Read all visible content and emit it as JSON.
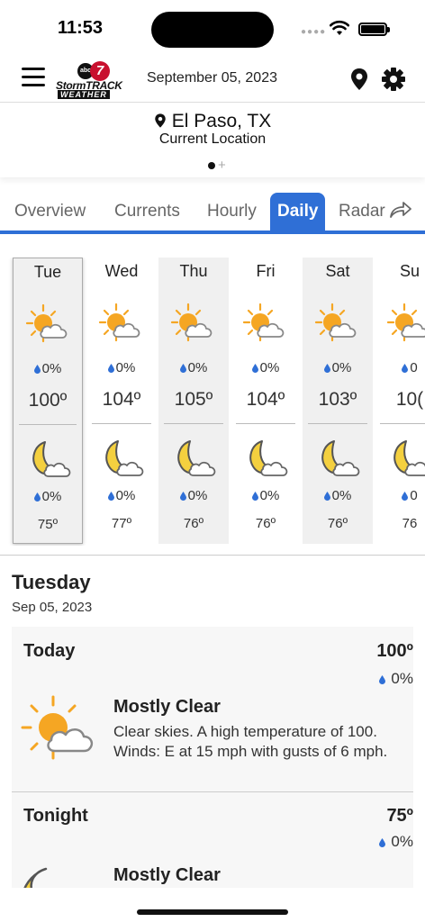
{
  "status_bar": {
    "time": "11:53"
  },
  "header": {
    "brand_line1": "StormTRACK",
    "brand_line2": "WEATHER",
    "brand_badge_abc": "abc",
    "brand_badge_num": "7",
    "date": "September 05, 2023"
  },
  "location": {
    "title": "El Paso, TX",
    "subtitle": "Current Location"
  },
  "tabs": [
    {
      "label": "Overview"
    },
    {
      "label": "Currents"
    },
    {
      "label": "Hourly"
    },
    {
      "label": "Daily"
    },
    {
      "label": "Radar"
    }
  ],
  "active_tab": "Daily",
  "daily": [
    {
      "day": "Tue",
      "precip_day": "0%",
      "high": "100º",
      "precip_night": "0%",
      "low": "75º",
      "day_icon": "partly-sunny-icon",
      "night_icon": "moon-cloud-icon"
    },
    {
      "day": "Wed",
      "precip_day": "0%",
      "high": "104º",
      "precip_night": "0%",
      "low": "77º",
      "day_icon": "partly-sunny-icon",
      "night_icon": "moon-cloud-icon"
    },
    {
      "day": "Thu",
      "precip_day": "0%",
      "high": "105º",
      "precip_night": "0%",
      "low": "76º",
      "day_icon": "partly-sunny-icon",
      "night_icon": "moon-cloud-icon"
    },
    {
      "day": "Fri",
      "precip_day": "0%",
      "high": "104º",
      "precip_night": "0%",
      "low": "76º",
      "day_icon": "partly-sunny-icon",
      "night_icon": "moon-cloud-icon"
    },
    {
      "day": "Sat",
      "precip_day": "0%",
      "high": "103º",
      "precip_night": "0%",
      "low": "76º",
      "day_icon": "partly-sunny-icon",
      "night_icon": "moon-cloud-icon"
    },
    {
      "day": "Su",
      "precip_day": "0",
      "high": "10(",
      "precip_night": "0",
      "low": "76",
      "day_icon": "partly-sunny-icon",
      "night_icon": "moon-cloud-icon"
    }
  ],
  "detail": {
    "day_name": "Tuesday",
    "date": "Sep 05, 2023",
    "periods": [
      {
        "name": "Today",
        "temp": "100º",
        "precip": "0%",
        "condition": "Mostly Clear",
        "description": "Clear skies. A high temperature of 100. Winds: E at 15 mph with gusts of 6 mph."
      },
      {
        "name": "Tonight",
        "temp": "75º",
        "precip": "0%",
        "condition": "Mostly Clear",
        "description": ""
      }
    ]
  },
  "colors": {
    "accent": "#2f6fd6",
    "sun": "#f5a623",
    "moon": "#f4d03f",
    "drop": "#2f6fd6"
  }
}
